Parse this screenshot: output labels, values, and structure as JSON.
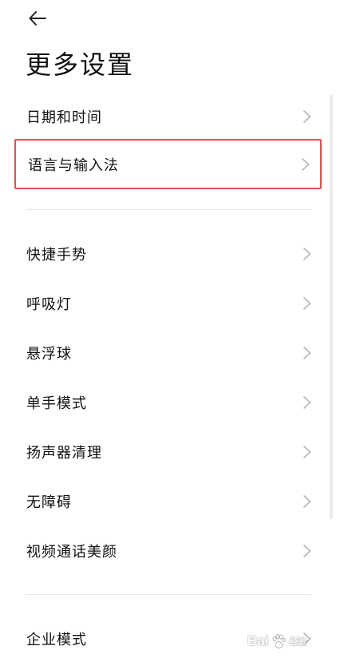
{
  "header": {
    "back_icon": "arrow-left-icon",
    "title": "更多设置"
  },
  "groups": [
    {
      "items": [
        {
          "key": "date-time",
          "label": "日期和时间",
          "highlighted": false
        },
        {
          "key": "language-input",
          "label": "语言与输入法",
          "highlighted": true
        }
      ]
    },
    {
      "items": [
        {
          "key": "shortcut-gestures",
          "label": "快捷手势",
          "highlighted": false
        },
        {
          "key": "breathing-light",
          "label": "呼吸灯",
          "highlighted": false
        },
        {
          "key": "floating-ball",
          "label": "悬浮球",
          "highlighted": false
        },
        {
          "key": "one-handed-mode",
          "label": "单手模式",
          "highlighted": false
        },
        {
          "key": "speaker-cleaning",
          "label": "扬声器清理",
          "highlighted": false
        },
        {
          "key": "accessibility",
          "label": "无障碍",
          "highlighted": false
        },
        {
          "key": "video-call-beauty",
          "label": "视频通话美颜",
          "highlighted": false
        }
      ]
    },
    {
      "items": [
        {
          "key": "enterprise-mode",
          "label": "企业模式",
          "highlighted": false
        }
      ]
    }
  ],
  "chevron_icon": "chevron-right-icon",
  "highlight_color": "#d9534f",
  "watermark": {
    "text": "Bai",
    "sub": "经验",
    "icon": "baidu-paw-icon"
  }
}
